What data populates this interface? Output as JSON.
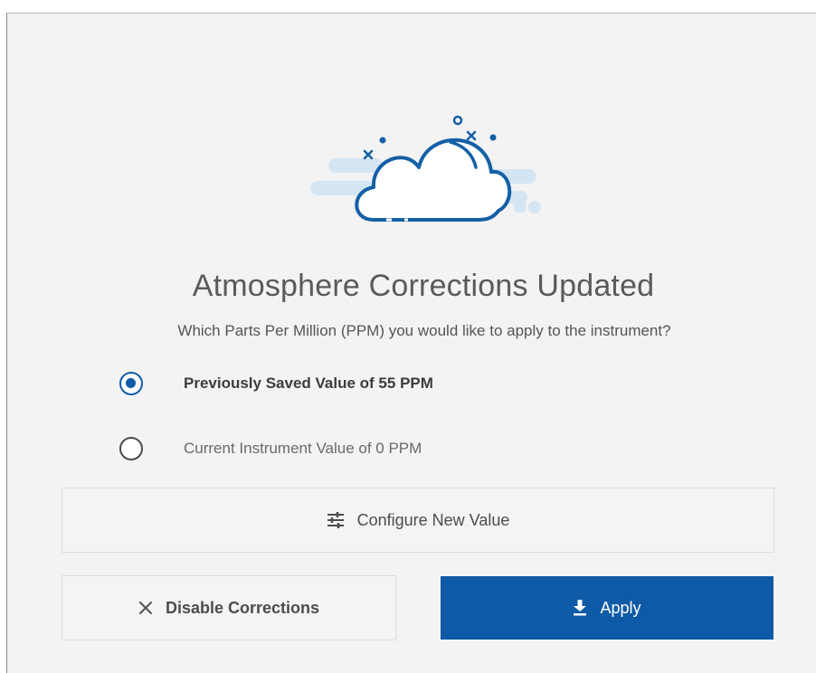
{
  "dialog": {
    "title": "Atmosphere Corrections Updated",
    "subtitle": "Which Parts Per Million (PPM) you would like to apply to the instrument?",
    "illustration": "cloud-icon"
  },
  "options": [
    {
      "label": "Previously Saved Value of 55 PPM",
      "selected": true
    },
    {
      "label": "Current Instrument Value of 0 PPM",
      "selected": false
    }
  ],
  "buttons": {
    "configure": {
      "label": "Configure New Value",
      "icon": "sliders-icon"
    },
    "disable": {
      "label": "Disable Corrections",
      "icon": "close-icon"
    },
    "apply": {
      "label": "Apply",
      "icon": "download-icon"
    }
  },
  "colors": {
    "accent": "#0e5aa6",
    "background": "#f3f3f3",
    "cloud_light": "#cfe3f3"
  }
}
